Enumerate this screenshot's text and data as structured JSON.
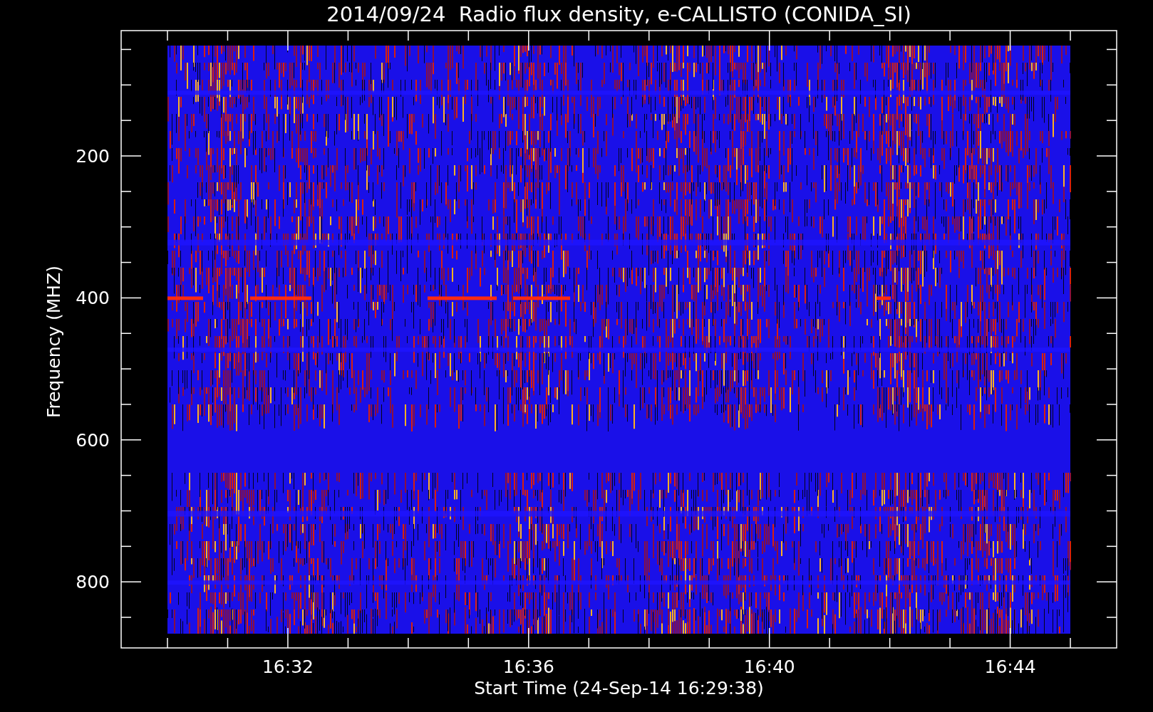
{
  "title": "2014/09/24  Radio flux density, e-CALLISTO (CONIDA_SI)",
  "y_axis": {
    "label": "Frequency (MHZ)",
    "ticks": [
      "200",
      "400",
      "600",
      "800"
    ]
  },
  "x_axis": {
    "label": "Start Time (24-Sep-14 16:29:38)",
    "ticks": [
      "16:32",
      "16:36",
      "16:40",
      "16:44"
    ]
  }
}
